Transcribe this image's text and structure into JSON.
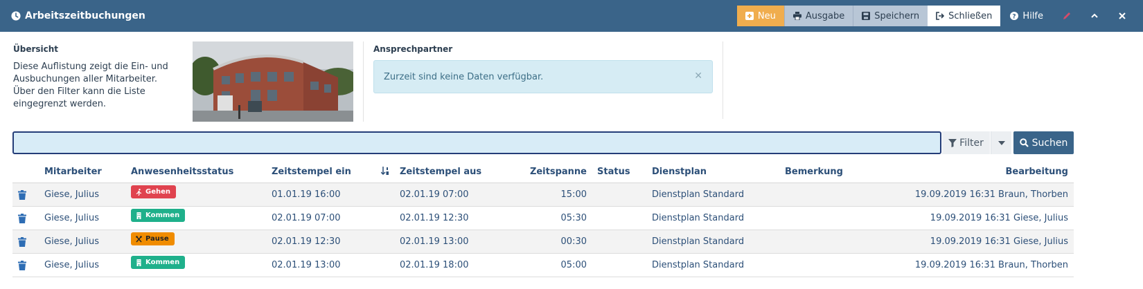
{
  "header": {
    "title": "Arbeitszeitbuchungen",
    "buttons": {
      "new": "Neu",
      "print": "Ausgabe",
      "save": "Speichern",
      "close": "Schließen",
      "help": "Hilfe"
    }
  },
  "overview": {
    "heading": "Übersicht",
    "text": "Diese Auflistung zeigt die Ein- und Ausbuchungen aller Mitarbeiter. Über den Filter kann die Liste eingegrenzt werden."
  },
  "contact": {
    "heading": "Ansprechpartner",
    "alert": "Zurzeit sind keine Daten verfügbar."
  },
  "search": {
    "value": "",
    "filter_label": "Filter",
    "search_label": "Suchen"
  },
  "table": {
    "columns": {
      "employee": "Mitarbeiter",
      "presence": "Anwesenheitsstatus",
      "ts_in": "Zeitstempel ein",
      "ts_out": "Zeitstempel aus",
      "span": "Zeitspanne",
      "status": "Status",
      "roster": "Dienstplan",
      "remark": "Bemerkung",
      "edit": "Bearbeitung"
    },
    "rows": [
      {
        "employee": "Giese, Julius",
        "presence": "Gehen",
        "presence_color": "#e0434f",
        "presence_icon": "walk-icon",
        "ts_in": "01.01.19 16:00",
        "ts_out": "02.01.19 07:00",
        "span": "15:00",
        "status": "",
        "roster": "Dienstplan Standard",
        "remark": "",
        "edit": "19.09.2019 16:31 Braun, Thorben"
      },
      {
        "employee": "Giese, Julius",
        "presence": "Kommen",
        "presence_color": "#1fb08b",
        "presence_icon": "building-icon",
        "ts_in": "02.01.19 07:00",
        "ts_out": "02.01.19 12:30",
        "span": "05:30",
        "status": "",
        "roster": "Dienstplan Standard",
        "remark": "",
        "edit": "19.09.2019 16:31 Giese, Julius"
      },
      {
        "employee": "Giese, Julius",
        "presence": "Pause",
        "presence_color": "#f08c00",
        "presence_icon": "cutlery-icon",
        "ts_in": "02.01.19 12:30",
        "ts_out": "02.01.19 13:00",
        "span": "00:30",
        "status": "",
        "roster": "Dienstplan Standard",
        "remark": "",
        "edit": "19.09.2019 16:31 Giese, Julius"
      },
      {
        "employee": "Giese, Julius",
        "presence": "Kommen",
        "presence_color": "#1fb08b",
        "presence_icon": "building-icon",
        "ts_in": "02.01.19 13:00",
        "ts_out": "02.01.19 18:00",
        "span": "05:00",
        "status": "",
        "roster": "Dienstplan Standard",
        "remark": "",
        "edit": "19.09.2019 16:31 Braun, Thorben"
      }
    ]
  },
  "colors": {
    "header_bg": "#3a6489",
    "new_button": "#f0ad4e",
    "search_button": "#3a6489"
  }
}
